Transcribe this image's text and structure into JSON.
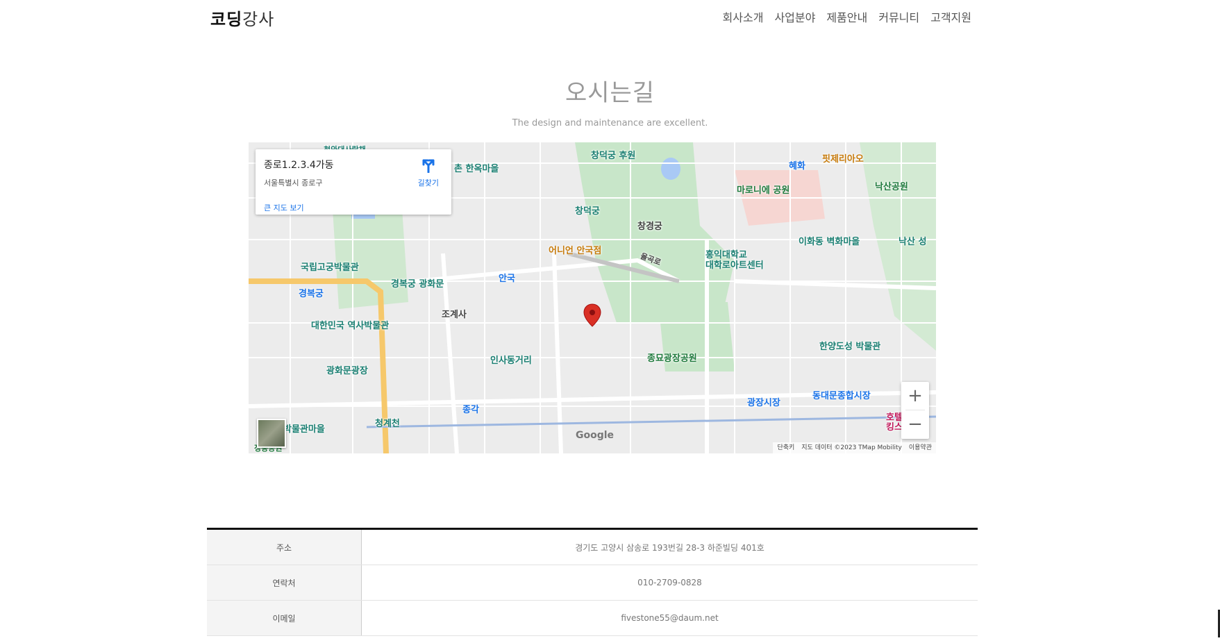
{
  "header": {
    "logo_part1": "코딩",
    "logo_part2": "강사",
    "nav": [
      "회사소개",
      "사업분야",
      "제품안내",
      "커뮤니티",
      "고객지원"
    ]
  },
  "section": {
    "title": "오시는길",
    "subtitle": "The design and maintenance are excellent."
  },
  "map": {
    "infobox": {
      "place": "종로1.2.3.4가동",
      "address": "서울특별시 종로구",
      "larger_map_link": "큰 지도 보기",
      "directions_label": "길찾기"
    },
    "labels": {
      "changdeokgung_garden": "창덕궁 후원",
      "changdeokgung": "창덕궁",
      "changgyeonggung": "창경궁",
      "hyehwa": "혜화",
      "pitjeria": "핏제리아오",
      "naksan": "낙산공원",
      "marronnier": "마로니에 공원",
      "ihwa_mural": "이화동 벽화마을",
      "hongik_art": "홍익대학교\n대학로아트센터",
      "onion": "어니언 안국점",
      "anguk": "안국",
      "gyeongbokgung_gwanghwamun": "경복궁 광화문",
      "gogung": "국립고궁박물관",
      "gyeongbokgung_station": "경복궁",
      "history_museum": "대한민국 역사박물관",
      "jogyesa": "조계사",
      "insadong": "인사동거리",
      "jongmyo_park": "종묘광장공원",
      "hanyang_museum": "한양도성 박물관",
      "gwanghwamun_square": "광화문광장",
      "jonggak": "종각",
      "cheonggyecheon": "청계천",
      "gwangjang": "광장시장",
      "dongdaemun": "동대문종합시장",
      "hotel": "호텔\n킹스",
      "museum_village": "박물관마을",
      "jeongdong": "정동공원",
      "bukchon": "촌 한옥마을",
      "yulgokro": "율곡로",
      "hanok_top": "청와대사랑채",
      "naksan_fort": "낙산 성"
    },
    "google": "Google",
    "attribution": [
      "단축키",
      "지도 데이터 ©2023 TMap Mobility",
      "이용약관"
    ]
  },
  "contact_table": [
    {
      "key": "주소",
      "value": "경기도 고양시 삼송로 193번길 28-3 하준빌딩 401호"
    },
    {
      "key": "연락처",
      "value": "010-2709-0828"
    },
    {
      "key": "이메일",
      "value": "fivestone55@daum.net"
    }
  ]
}
